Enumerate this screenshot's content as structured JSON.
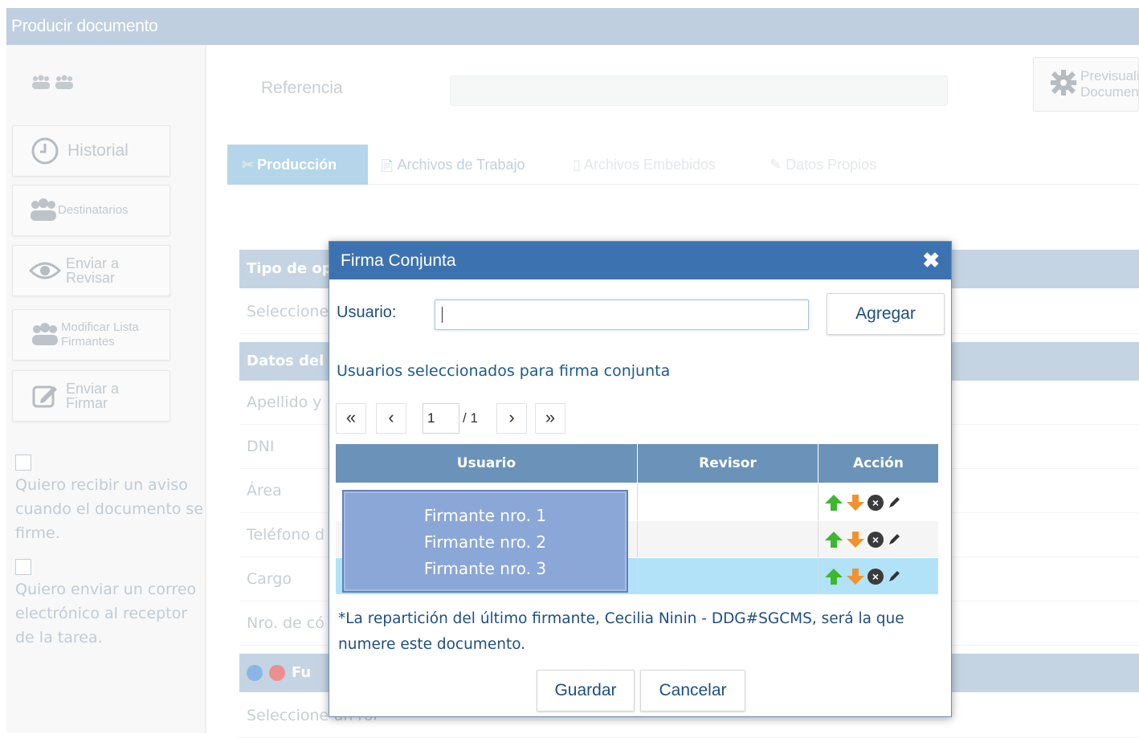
{
  "window": {
    "title": "Producir documento"
  },
  "sidebar": {
    "historial_label": "Historial",
    "destinatarios_label": "Destinatarios",
    "revisar_label_1": "Enviar a",
    "revisar_label_2": "Revisar",
    "modificar_label_1": "Modificar Lista",
    "modificar_label_2": "Firmantes",
    "firmar_label_1": "Enviar a",
    "firmar_label_2": "Firmar",
    "aviso_text": "Quiero recibir un aviso cuando el documento se firme.",
    "correo_text": "Quiero enviar un correo electrónico al receptor de la tarea."
  },
  "header": {
    "referencia_label": "Referencia",
    "referencia_value": "",
    "preview_label_1": "Previsualizar",
    "preview_label_2": "Documento"
  },
  "tabs": [
    {
      "label": "Producción",
      "active": true
    },
    {
      "label": "Archivos de Trabajo"
    },
    {
      "label": "Archivos Embebidos"
    },
    {
      "label": "Datos Propios"
    }
  ],
  "form": {
    "tipo_header": "Tipo de op",
    "tipo_row": "Seleccione",
    "datos_header": "Datos del",
    "rows": [
      "Apellido y",
      "DNI",
      "Área",
      "Teléfono d",
      "Cargo",
      "Nro. de có"
    ],
    "fu_header": "Fu",
    "last_row": "Seleccione un rol"
  },
  "modal": {
    "title": "Firma Conjunta",
    "close_glyph": "✖",
    "usuario_label": "Usuario:",
    "usuario_value": "",
    "add_label": "Agregar",
    "selected_title": "Usuarios seleccionados para firma conjunta",
    "pager": {
      "first": "«",
      "prev": "‹",
      "page": "1",
      "total": "/ 1",
      "next": "›",
      "last": "»"
    },
    "grid": {
      "columns": [
        "Usuario",
        "Revisor",
        "Acción"
      ],
      "rows": [
        {
          "usuario": "Firmante nro. 1",
          "revisor": ""
        },
        {
          "usuario": "Firmante nro. 2",
          "revisor": ""
        },
        {
          "usuario": "Firmante nro. 3",
          "revisor": ""
        }
      ]
    },
    "note": "*La repartición del último firmante, Cecilia Ninin - DDG#SGCMS, será la que numere este documento.",
    "save_label": "Guardar",
    "cancel_label": "Cancelar"
  },
  "colors": {
    "titlebar": "#9db6d0",
    "modal_header": "#3d72b0",
    "grid_header": "#6b93b9",
    "selected_row": "#b2e2f7",
    "arrow_up": "#3db82e",
    "arrow_down": "#f0922d",
    "text_blue": "#1f4f7e"
  },
  "icons": {
    "up": "arrow-up-icon",
    "down": "arrow-down-icon",
    "remove": "remove-circle-icon",
    "edit": "pencil-icon"
  }
}
